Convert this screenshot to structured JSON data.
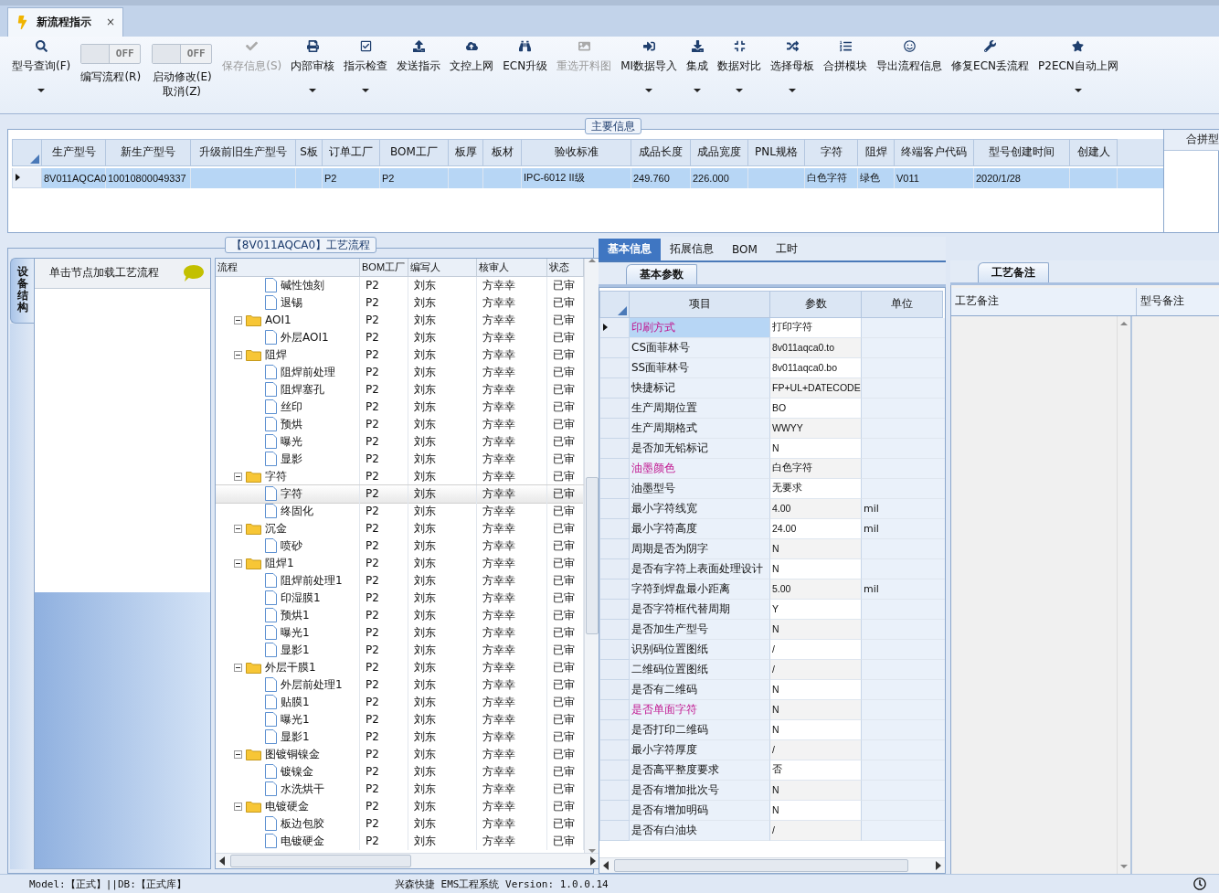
{
  "tab": {
    "title": "新流程指示",
    "close": "×"
  },
  "toolbar": [
    {
      "kind": "button",
      "lines": [
        "型号查询(F)"
      ],
      "disabled": false,
      "dropdown": true
    },
    {
      "kind": "toggle",
      "state_text": "OFF",
      "on": false,
      "lines": [
        "编写流程(R)"
      ]
    },
    {
      "kind": "toggle",
      "state_text": "OFF",
      "on": false,
      "lines": [
        "启动修改(E)",
        "取消(Z)"
      ]
    },
    {
      "kind": "button",
      "lines": [
        "保存信息(S)"
      ],
      "disabled": true,
      "dropdown": false
    },
    {
      "kind": "button",
      "lines": [
        "内部审核"
      ],
      "disabled": false,
      "dropdown": true
    },
    {
      "kind": "button",
      "lines": [
        "指示检查"
      ],
      "disabled": false,
      "dropdown": true
    },
    {
      "kind": "button",
      "lines": [
        "发送指示"
      ],
      "disabled": false,
      "dropdown": false
    },
    {
      "kind": "button",
      "lines": [
        "文控上网"
      ],
      "disabled": false,
      "dropdown": false
    },
    {
      "kind": "button",
      "lines": [
        "ECN升级"
      ],
      "disabled": false,
      "dropdown": false
    },
    {
      "kind": "button",
      "lines": [
        "重选开料图"
      ],
      "disabled": true,
      "dropdown": false
    },
    {
      "kind": "button",
      "lines": [
        "MI数据导入"
      ],
      "disabled": false,
      "dropdown": true
    },
    {
      "kind": "button",
      "lines": [
        "集成"
      ],
      "disabled": false,
      "dropdown": true
    },
    {
      "kind": "button",
      "lines": [
        "数据对比"
      ],
      "disabled": false,
      "dropdown": true
    },
    {
      "kind": "button",
      "lines": [
        "选择母板"
      ],
      "disabled": false,
      "dropdown": true
    },
    {
      "kind": "button",
      "lines": [
        "合拼模块"
      ],
      "disabled": false,
      "dropdown": false
    },
    {
      "kind": "button",
      "lines": [
        "导出流程信息"
      ],
      "disabled": false,
      "dropdown": false
    },
    {
      "kind": "button",
      "lines": [
        "修复ECN丢流程"
      ],
      "disabled": false,
      "dropdown": false
    },
    {
      "kind": "button",
      "lines": [
        "P2ECN自动上网"
      ],
      "disabled": false,
      "dropdown": true
    }
  ],
  "main_info": {
    "title": "主要信息",
    "columns": [
      "生产型号",
      "新生产型号",
      "升级前旧生产型号",
      "S板",
      "订单工厂",
      "BOM工厂",
      "板厚",
      "板材",
      "验收标准",
      "成品长度",
      "成品宽度",
      "PNL规格",
      "字符",
      "阻焊",
      "终端客户代码",
      "型号创建时间",
      "创建人"
    ],
    "rows": [
      {
        "selected": true,
        "cells": [
          "8V011AQCA0",
          "10010800049337",
          null,
          null,
          "P2",
          "P2",
          null,
          null,
          "IPC-6012 II级",
          "249.760",
          "226.000",
          null,
          "白色字符",
          "绿色",
          "V011",
          "2020/1/28",
          null
        ]
      }
    ],
    "side_panel": {
      "title": "合拼型"
    }
  },
  "process": {
    "title": "【8V011AQCA0】工艺流程",
    "side_tab": "设备结构",
    "hint": "单击节点加载工艺流程",
    "columns": [
      "流程",
      "BOM工厂",
      "编写人",
      "核审人",
      "状态"
    ],
    "tree": [
      {
        "children": [
          {
            "label": "碱性蚀刻",
            "bom": "P2",
            "writer": "刘东",
            "reviewer": "方幸幸",
            "status": "已审",
            "selected": false
          },
          {
            "label": "退锡",
            "bom": "P2",
            "writer": "刘东",
            "reviewer": "方幸幸",
            "status": "已审",
            "selected": false
          }
        ]
      },
      {
        "label": "AOI1",
        "bom": "P2",
        "writer": "刘东",
        "reviewer": "方幸幸",
        "status": "已审",
        "selected": false,
        "expanded": true,
        "children": [
          {
            "label": "外层AOI1",
            "bom": "P2",
            "writer": "刘东",
            "reviewer": "方幸幸",
            "status": "已审",
            "selected": false
          }
        ]
      },
      {
        "label": "阻焊",
        "bom": "P2",
        "writer": "刘东",
        "reviewer": "方幸幸",
        "status": "已审",
        "selected": false,
        "expanded": true,
        "children": [
          {
            "label": "阻焊前处理",
            "bom": "P2",
            "writer": "刘东",
            "reviewer": "方幸幸",
            "status": "已审",
            "selected": false
          },
          {
            "label": "阻焊塞孔",
            "bom": "P2",
            "writer": "刘东",
            "reviewer": "方幸幸",
            "status": "已审",
            "selected": false
          },
          {
            "label": "丝印",
            "bom": "P2",
            "writer": "刘东",
            "reviewer": "方幸幸",
            "status": "已审",
            "selected": false
          },
          {
            "label": "预烘",
            "bom": "P2",
            "writer": "刘东",
            "reviewer": "方幸幸",
            "status": "已审",
            "selected": false
          },
          {
            "label": "曝光",
            "bom": "P2",
            "writer": "刘东",
            "reviewer": "方幸幸",
            "status": "已审",
            "selected": false
          },
          {
            "label": "显影",
            "bom": "P2",
            "writer": "刘东",
            "reviewer": "方幸幸",
            "status": "已审",
            "selected": false
          }
        ]
      },
      {
        "label": "字符",
        "bom": "P2",
        "writer": "刘东",
        "reviewer": "方幸幸",
        "status": "已审",
        "selected": false,
        "expanded": true,
        "children": [
          {
            "label": "字符",
            "bom": "P2",
            "writer": "刘东",
            "reviewer": "方幸幸",
            "status": "已审",
            "selected": true
          },
          {
            "label": "终固化",
            "bom": "P2",
            "writer": "刘东",
            "reviewer": "方幸幸",
            "status": "已审",
            "selected": false
          }
        ]
      },
      {
        "label": "沉金",
        "bom": "P2",
        "writer": "刘东",
        "reviewer": "方幸幸",
        "status": "已审",
        "selected": false,
        "expanded": true,
        "children": [
          {
            "label": "喷砂",
            "bom": "P2",
            "writer": "刘东",
            "reviewer": "方幸幸",
            "status": "已审",
            "selected": false
          }
        ]
      },
      {
        "label": "阻焊1",
        "bom": "P2",
        "writer": "刘东",
        "reviewer": "方幸幸",
        "status": "已审",
        "selected": false,
        "expanded": true,
        "children": [
          {
            "label": "阻焊前处理1",
            "bom": "P2",
            "writer": "刘东",
            "reviewer": "方幸幸",
            "status": "已审",
            "selected": false
          },
          {
            "label": "印湿膜1",
            "bom": "P2",
            "writer": "刘东",
            "reviewer": "方幸幸",
            "status": "已审",
            "selected": false
          },
          {
            "label": "预烘1",
            "bom": "P2",
            "writer": "刘东",
            "reviewer": "方幸幸",
            "status": "已审",
            "selected": false
          },
          {
            "label": "曝光1",
            "bom": "P2",
            "writer": "刘东",
            "reviewer": "方幸幸",
            "status": "已审",
            "selected": false
          },
          {
            "label": "显影1",
            "bom": "P2",
            "writer": "刘东",
            "reviewer": "方幸幸",
            "status": "已审",
            "selected": false
          }
        ]
      },
      {
        "label": "外层干膜1",
        "bom": "P2",
        "writer": "刘东",
        "reviewer": "方幸幸",
        "status": "已审",
        "selected": false,
        "expanded": true,
        "children": [
          {
            "label": "外层前处理1",
            "bom": "P2",
            "writer": "刘东",
            "reviewer": "方幸幸",
            "status": "已审",
            "selected": false
          },
          {
            "label": "贴膜1",
            "bom": "P2",
            "writer": "刘东",
            "reviewer": "方幸幸",
            "status": "已审",
            "selected": false
          },
          {
            "label": "曝光1",
            "bom": "P2",
            "writer": "刘东",
            "reviewer": "方幸幸",
            "status": "已审",
            "selected": false
          },
          {
            "label": "显影1",
            "bom": "P2",
            "writer": "刘东",
            "reviewer": "方幸幸",
            "status": "已审",
            "selected": false
          }
        ]
      },
      {
        "label": "图镀铜镍金",
        "bom": "P2",
        "writer": "刘东",
        "reviewer": "方幸幸",
        "status": "已审",
        "selected": false,
        "expanded": true,
        "children": [
          {
            "label": "镀镍金",
            "bom": "P2",
            "writer": "刘东",
            "reviewer": "方幸幸",
            "status": "已审",
            "selected": false
          },
          {
            "label": "水洗烘干",
            "bom": "P2",
            "writer": "刘东",
            "reviewer": "方幸幸",
            "status": "已审",
            "selected": false
          }
        ]
      },
      {
        "label": "电镀硬金",
        "bom": "P2",
        "writer": "刘东",
        "reviewer": "方幸幸",
        "status": "已审",
        "selected": false,
        "expanded": true,
        "children": [
          {
            "label": "板边包胶",
            "bom": "P2",
            "writer": "刘东",
            "reviewer": "方幸幸",
            "status": "已审",
            "selected": false
          },
          {
            "label": "电镀硬金",
            "bom": "P2",
            "writer": "刘东",
            "reviewer": "方幸幸",
            "status": "已审",
            "selected": false
          }
        ]
      }
    ]
  },
  "detail": {
    "tabs": [
      {
        "label": "基本信息",
        "selected": true
      },
      {
        "label": "拓展信息",
        "selected": false
      },
      {
        "label": "BOM",
        "selected": false
      },
      {
        "label": "工时",
        "selected": false
      }
    ],
    "subtab": "基本参数",
    "columns": [
      "项目",
      "参数",
      "单位"
    ],
    "rows": [
      {
        "item": "印刷方式",
        "value": "打印字符",
        "emphasized": true,
        "selected": true
      },
      {
        "item": "CS面菲林号",
        "value": "8v011aqca0.to",
        "emphasized": false,
        "selected": false
      },
      {
        "item": "SS面菲林号",
        "value": "8v011aqca0.bo",
        "emphasized": false,
        "selected": false
      },
      {
        "item": "快捷标记",
        "value": "FP+UL+DATECODE",
        "emphasized": false,
        "selected": false
      },
      {
        "item": "生产周期位置",
        "value": "BO",
        "emphasized": false,
        "selected": false
      },
      {
        "item": "生产周期格式",
        "value": "WWYY",
        "emphasized": false,
        "selected": false
      },
      {
        "item": "是否加无铅标记",
        "value": "N",
        "emphasized": false,
        "selected": false
      },
      {
        "item": "油墨颜色",
        "value": "白色字符",
        "emphasized": true,
        "selected": false
      },
      {
        "item": "油墨型号",
        "value": "无要求",
        "emphasized": false,
        "selected": false
      },
      {
        "item": "最小字符线宽",
        "value": "4.00",
        "unit": "mil",
        "emphasized": false,
        "selected": false
      },
      {
        "item": "最小字符高度",
        "value": "24.00",
        "unit": "mil",
        "emphasized": false,
        "selected": false
      },
      {
        "item": "周期是否为阴字",
        "value": "N",
        "emphasized": false,
        "selected": false
      },
      {
        "item": "是否有字符上表面处理设计",
        "value": "N",
        "emphasized": false,
        "selected": false
      },
      {
        "item": "字符到焊盘最小距离",
        "value": "5.00",
        "unit": "mil",
        "emphasized": false,
        "selected": false
      },
      {
        "item": "是否字符框代替周期",
        "value": "Y",
        "emphasized": false,
        "selected": false
      },
      {
        "item": "是否加生产型号",
        "value": "N",
        "emphasized": false,
        "selected": false
      },
      {
        "item": "识别码位置图纸",
        "value": "/",
        "emphasized": false,
        "selected": false
      },
      {
        "item": "二维码位置图纸",
        "value": "/",
        "emphasized": false,
        "selected": false
      },
      {
        "item": "是否有二维码",
        "value": "N",
        "emphasized": false,
        "selected": false
      },
      {
        "item": "是否单面字符",
        "value": "N",
        "emphasized": true,
        "selected": false
      },
      {
        "item": "是否打印二维码",
        "value": "N",
        "emphasized": false,
        "selected": false
      },
      {
        "item": "最小字符厚度",
        "value": "/",
        "emphasized": false,
        "selected": false
      },
      {
        "item": "是否高平整度要求",
        "value": "否",
        "emphasized": false,
        "selected": false
      },
      {
        "item": "是否有增加批次号",
        "value": "N",
        "emphasized": false,
        "selected": false
      },
      {
        "item": "是否有增加明码",
        "value": "N",
        "emphasized": false,
        "selected": false
      },
      {
        "item": "是否有白油块",
        "value": "/",
        "emphasized": false,
        "selected": false
      }
    ]
  },
  "notes": {
    "tab": "工艺备注",
    "columns": [
      "工艺备注",
      "型号备注"
    ]
  },
  "status_bar": {
    "left": "Model:【正式】||DB:【正式库】",
    "center": "兴森快捷 EMS工程系统 Version: 1.0.0.14"
  }
}
